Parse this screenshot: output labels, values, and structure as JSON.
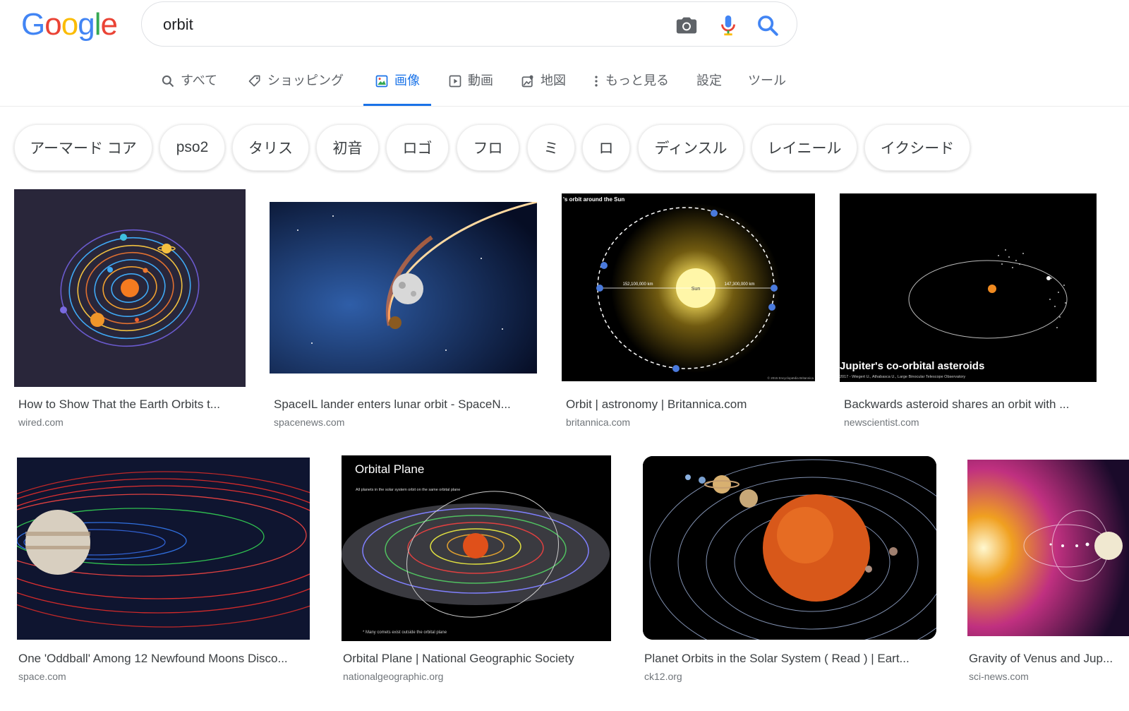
{
  "logo": {
    "letters": [
      "G",
      "o",
      "o",
      "g",
      "l",
      "e"
    ],
    "colors": [
      "#4285F4",
      "#EA4335",
      "#FBBC05",
      "#4285F4",
      "#34A853",
      "#EA4335"
    ]
  },
  "search": {
    "query": "orbit",
    "camera_icon": "camera-icon",
    "mic_icon": "mic-icon",
    "search_icon": "search-icon"
  },
  "tabs": [
    {
      "label": "すべて",
      "icon": "search-icon"
    },
    {
      "label": "ショッピング",
      "icon": "tag-icon"
    },
    {
      "label": "画像",
      "icon": "image-icon",
      "active": true
    },
    {
      "label": "動画",
      "icon": "video-icon"
    },
    {
      "label": "地図",
      "icon": "map-icon"
    },
    {
      "label": "もっと見る",
      "icon": "more-vert-icon"
    },
    {
      "label": "設定"
    },
    {
      "label": "ツール"
    }
  ],
  "chips": [
    "アーマード コア",
    "pso2",
    "タリス",
    "初音",
    "ロゴ",
    "フロ",
    "ミ",
    "ロ",
    "ディンスル",
    "レイニール",
    "イクシード"
  ],
  "results": [
    {
      "title": "How to Show That the Earth Orbits t...",
      "domain": "wired.com"
    },
    {
      "title": "SpaceIL lander enters lunar orbit - SpaceN...",
      "domain": "spacenews.com"
    },
    {
      "title": "Orbit | astronomy | Britannica.com",
      "domain": "britannica.com",
      "overlay": "'s orbit around the Sun",
      "sun_label": "Sun",
      "dist_left": "152,100,000 km",
      "dist_right": "147,300,000 km",
      "credit": "© 2015 Encyclopædia Britannica"
    },
    {
      "title": "Backwards asteroid shares an orbit with ...",
      "domain": "newscientist.com",
      "overlay": "Jupiter's co-orbital asteroids",
      "credit": "2017 - Wiegert U., Athabasca U., Large Binocular Telescope Observatory"
    },
    {
      "title": "One 'Oddball' Among 12 Newfound Moons Disco...",
      "domain": "space.com"
    },
    {
      "title": "Orbital Plane | National Geographic Society",
      "domain": "nationalgeographic.org",
      "overlay": "Orbital Plane",
      "note": "All planets in the solar system orbit on the same orbital plane",
      "footnote": "* Many comets exist outside the orbital plane"
    },
    {
      "title": "Planet Orbits in the Solar System ( Read ) | Eart...",
      "domain": "ck12.org"
    },
    {
      "title": "Gravity of Venus and Jup...",
      "domain": "sci-news.com"
    }
  ]
}
